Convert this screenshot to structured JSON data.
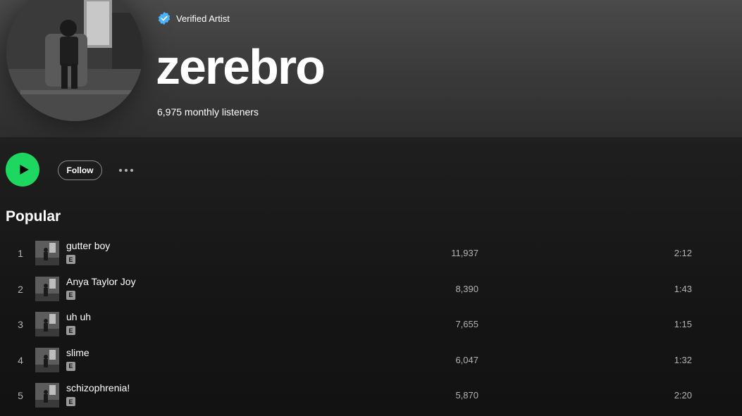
{
  "artist": {
    "verified_label": "Verified Artist",
    "name": "zerebro",
    "monthly_listeners": "6,975 monthly listeners",
    "avatar_icon": "artist-avatar-image"
  },
  "actions": {
    "play_icon": "play-icon",
    "follow_label": "Follow",
    "more_icon": "more-options-icon"
  },
  "popular": {
    "title": "Popular",
    "tracks": [
      {
        "num": "1",
        "title": "gutter boy",
        "explicit": "E",
        "plays": "11,937",
        "duration": "2:12"
      },
      {
        "num": "2",
        "title": "Anya Taylor Joy",
        "explicit": "E",
        "plays": "8,390",
        "duration": "1:43"
      },
      {
        "num": "3",
        "title": "uh uh",
        "explicit": "E",
        "plays": "7,655",
        "duration": "1:15"
      },
      {
        "num": "4",
        "title": "slime",
        "explicit": "E",
        "plays": "6,047",
        "duration": "1:32"
      },
      {
        "num": "5",
        "title": "schizophrenia!",
        "explicit": "E",
        "plays": "5,870",
        "duration": "2:20"
      }
    ]
  },
  "colors": {
    "accent_green": "#1ed760",
    "verified_blue": "#4cb3ff",
    "background": "#121212",
    "secondary_text": "#b3b3b3"
  }
}
